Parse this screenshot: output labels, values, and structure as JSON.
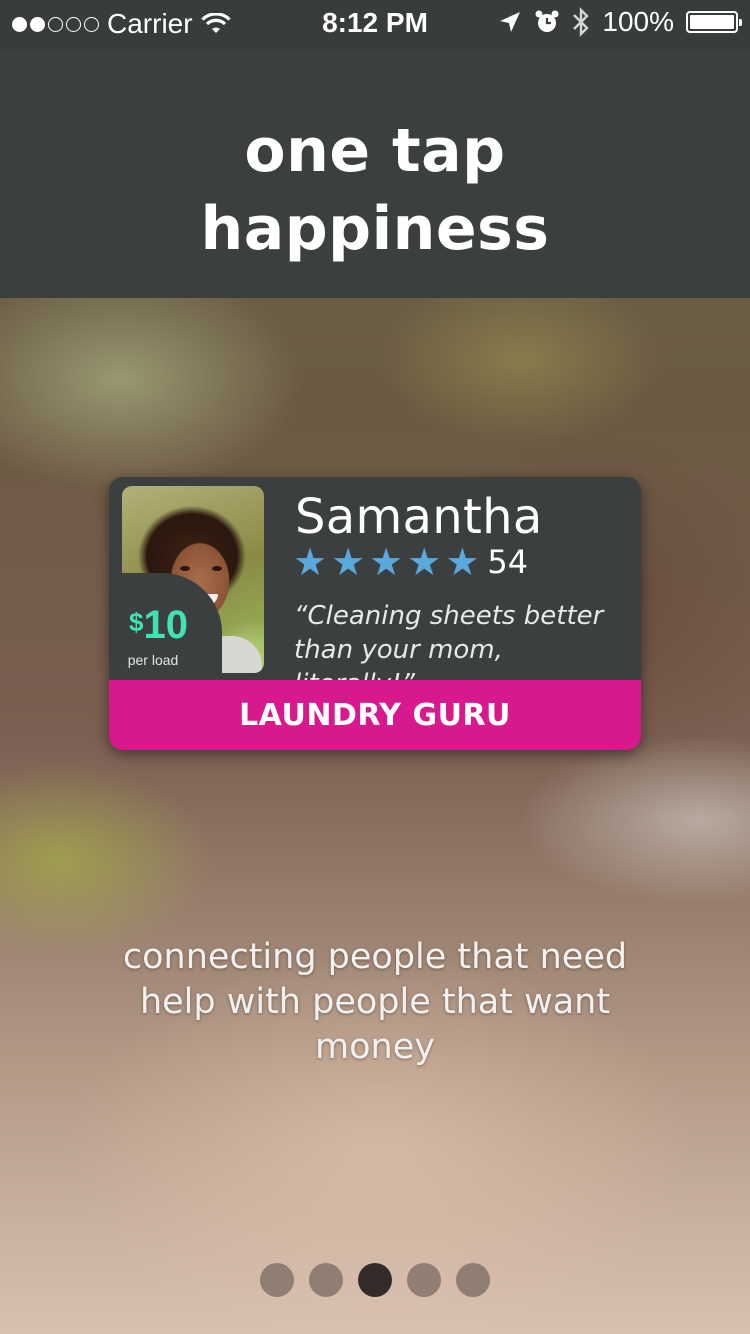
{
  "status_bar": {
    "carrier": "Carrier",
    "time": "8:12 PM",
    "battery": "100%",
    "signal_strength": 2,
    "signal_max": 5,
    "icons": [
      "wifi-icon",
      "location-icon",
      "alarm-icon",
      "bluetooth-icon",
      "battery-icon"
    ]
  },
  "header": {
    "title_line1": "one tap",
    "title_line2": "happiness"
  },
  "profile_card": {
    "name": "Samantha",
    "stars": 5,
    "rating_count": "54",
    "quote_line1": "“Cleaning sheets better",
    "quote_line2": "than your mom, literally!”",
    "price_currency": "$",
    "price_amount": "10",
    "price_unit": "per load",
    "cta_label": "LAUNDRY GURU",
    "colors": {
      "price": "#3ee5b0",
      "stars": "#5ba9dc",
      "cta": "#d8198e"
    }
  },
  "tagline": {
    "line1": "connecting people that need",
    "line2": "help with people that want",
    "line3": "money"
  },
  "pager": {
    "count": 5,
    "active_index": 2
  },
  "colors": {
    "header_bg": "#3b3f40",
    "status_bg": "#383c3d"
  }
}
